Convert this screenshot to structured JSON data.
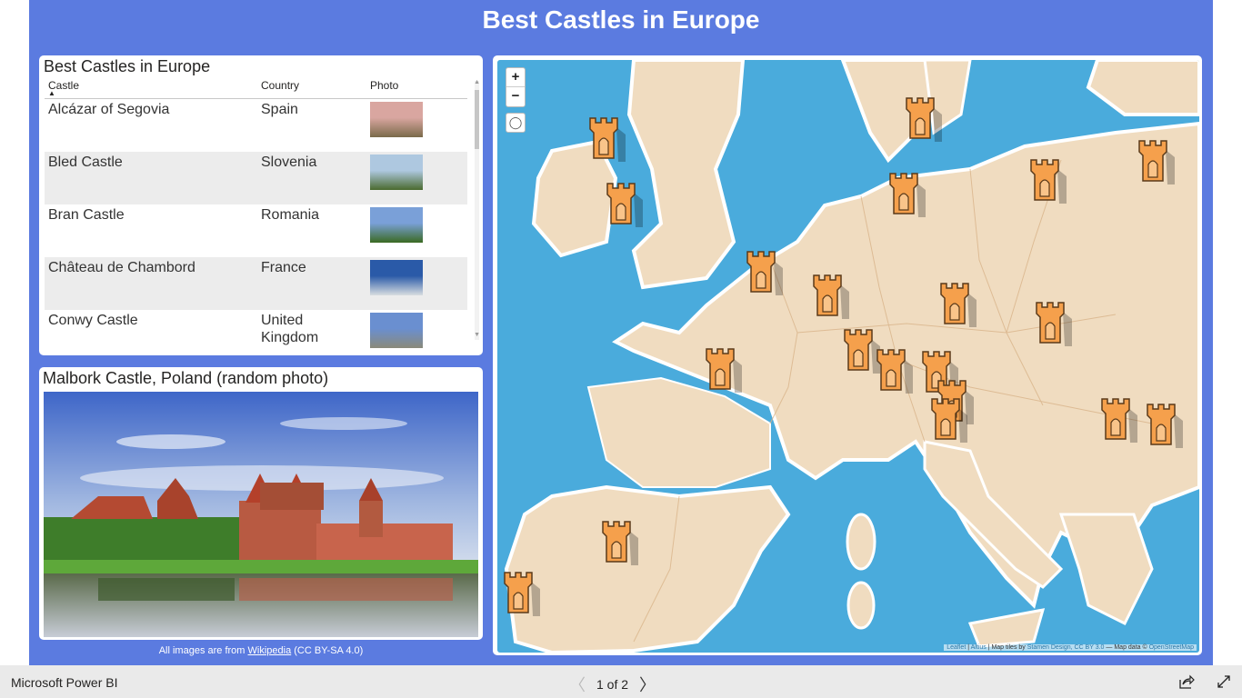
{
  "report": {
    "title": "Best Castles in Europe"
  },
  "table": {
    "title": "Best Castles in Europe",
    "columns": [
      "Castle",
      "Country",
      "Photo"
    ],
    "sort": {
      "column": "Castle",
      "direction": "ascending"
    },
    "rows": [
      {
        "castle": "Alcázar of Segovia",
        "country": "Spain",
        "photo": "castle-photo-thumbnail"
      },
      {
        "castle": "Bled Castle",
        "country": "Slovenia",
        "photo": "castle-photo-thumbnail"
      },
      {
        "castle": "Bran Castle",
        "country": "Romania",
        "photo": "castle-photo-thumbnail"
      },
      {
        "castle": "Château de Chambord",
        "country": "France",
        "photo": "castle-photo-thumbnail"
      },
      {
        "castle": "Conwy Castle",
        "country": "United Kingdom",
        "photo": "castle-photo-thumbnail"
      }
    ]
  },
  "photo_card": {
    "title": "Malbork Castle, Poland (random photo)"
  },
  "footnote": {
    "prefix": "All images are from ",
    "link": "Wikipedia",
    "suffix": " (CC BY-SA 4.0)"
  },
  "map": {
    "zoom_in": "+",
    "zoom_out": "−",
    "lasso_icon": "lasso-select-icon",
    "marker_icon": "castle-tower-icon",
    "marker_color": "#f5a04c",
    "marker_count": 20,
    "attribution": {
      "leaflet": "Leaflet",
      "altius": "Altius",
      "tiles_text": " | Map tiles by ",
      "stamen": "Stamen Design, CC BY 3.0",
      "data_text": " — Map data © ",
      "osm": "OpenStreetMap"
    }
  },
  "bottom_bar": {
    "brand": "Microsoft Power BI",
    "page_indicator": "1 of 2",
    "prev_icon": "chevron-left-icon",
    "next_icon": "chevron-right-icon",
    "share_icon": "share-icon",
    "expand_icon": "fullscreen-icon"
  },
  "colors": {
    "canvas": "#5b7be0",
    "marker": "#f5a04c",
    "bottom_bar": "#eaeaea"
  }
}
